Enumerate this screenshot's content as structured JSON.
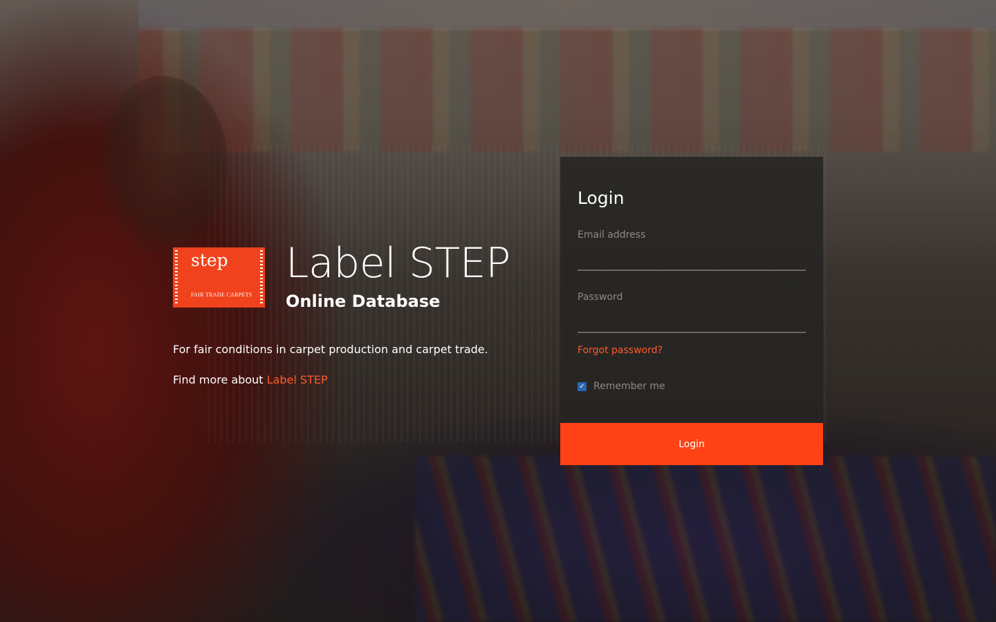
{
  "brand": {
    "logo_word": "step",
    "logo_sub": "FAIR TRADE CARPETS",
    "title": "Label STEP",
    "subtitle": "Online Database",
    "tagline": "For fair conditions in carpet production and carpet trade.",
    "more_prefix": "Find more about ",
    "more_link": "Label STEP"
  },
  "login": {
    "title": "Login",
    "email_label": "Email address",
    "email_value": "",
    "password_label": "Password",
    "password_value": "",
    "forgot_label": "Forgot password?",
    "remember_label": "Remember me",
    "remember_checked": true,
    "submit_label": "Login"
  },
  "colors": {
    "accent": "#ff4215",
    "link": "#ff5a2b",
    "card_bg": "#262422",
    "checkbox": "#2c66b3"
  },
  "icons": {
    "logo": "step-logo",
    "checkbox": "check-icon"
  }
}
